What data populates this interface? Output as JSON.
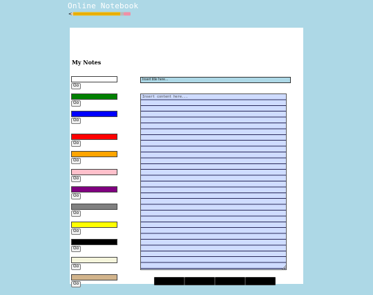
{
  "app": {
    "title": "Online Notebook"
  },
  "header": {
    "pencil_icon": "pencil-icon"
  },
  "notes": {
    "heading": "My Notes",
    "go_label": "Go",
    "items": [
      {
        "color": "#ffffff"
      },
      {
        "color": "#008000"
      },
      {
        "color": "#0000ff"
      },
      {
        "color": "#ff0000"
      },
      {
        "color": "#ffa500"
      },
      {
        "color": "#ffc0cb"
      },
      {
        "color": "#800080"
      },
      {
        "color": "#808080"
      },
      {
        "color": "#ffff00"
      },
      {
        "color": "#000000"
      },
      {
        "color": "#f5f5dc"
      },
      {
        "color": "#d2b48c"
      }
    ]
  },
  "editor": {
    "title_placeholder": "Insert title here...",
    "content_placeholder": "Insert content here..."
  },
  "colors": {
    "page_background": "#add8e6",
    "title_field": "#add8e6",
    "content_background": "#cfdcff",
    "action_buttons": "#000000"
  }
}
